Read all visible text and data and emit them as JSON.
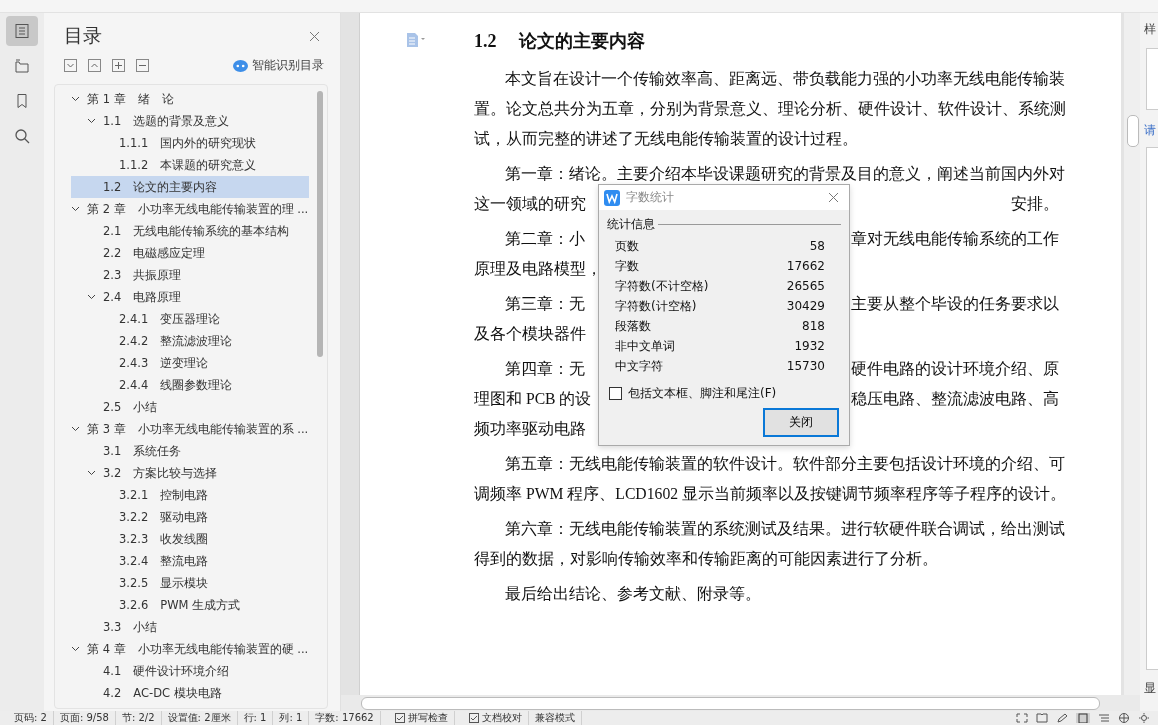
{
  "rail": [
    {
      "kind": "toc",
      "selected": true
    },
    {
      "kind": "nav",
      "selected": false
    },
    {
      "kind": "bookmark",
      "selected": false
    },
    {
      "kind": "search",
      "selected": false
    }
  ],
  "toc": {
    "title": "目录",
    "smart_label": "智能识别目录",
    "items": [
      {
        "number": "第 1 章",
        "title": "绪　论",
        "expanded": true,
        "selected": false,
        "children": [
          {
            "number": "1.1",
            "title": "选题的背景及意义",
            "expanded": true,
            "selected": false,
            "children": [
              {
                "number": "1.1.1",
                "title": "国内外的研究现状",
                "selected": false
              },
              {
                "number": "1.1.2",
                "title": "本课题的研究意义",
                "selected": false
              }
            ]
          },
          {
            "number": "1.2",
            "title": "论文的主要内容",
            "selected": true
          }
        ]
      },
      {
        "number": "第 2 章",
        "title": "小功率无线电能传输装置的理 ...",
        "expanded": true,
        "selected": false,
        "children": [
          {
            "number": "2.1",
            "title": "无线电能传输系统的基本结构",
            "selected": false
          },
          {
            "number": "2.2",
            "title": "电磁感应定理",
            "selected": false
          },
          {
            "number": "2.3",
            "title": "共振原理",
            "selected": false
          },
          {
            "number": "2.4",
            "title": "电路原理",
            "expanded": true,
            "selected": false,
            "children": [
              {
                "number": "2.4.1",
                "title": "变压器理论",
                "selected": false
              },
              {
                "number": "2.4.2",
                "title": "整流滤波理论",
                "selected": false
              },
              {
                "number": "2.4.3",
                "title": "逆变理论",
                "selected": false
              },
              {
                "number": "2.4.4",
                "title": "线圈参数理论",
                "selected": false
              }
            ]
          },
          {
            "number": "2.5",
            "title": "小结",
            "selected": false
          }
        ]
      },
      {
        "number": "第 3 章",
        "title": "小功率无线电能传输装置的系 ...",
        "expanded": true,
        "selected": false,
        "children": [
          {
            "number": "3.1",
            "title": "系统任务",
            "selected": false
          },
          {
            "number": "3.2",
            "title": "方案比较与选择",
            "expanded": true,
            "selected": false,
            "children": [
              {
                "number": "3.2.1",
                "title": "控制电路",
                "selected": false
              },
              {
                "number": "3.2.2",
                "title": "驱动电路",
                "selected": false
              },
              {
                "number": "3.2.3",
                "title": "收发线圈",
                "selected": false
              },
              {
                "number": "3.2.4",
                "title": "整流电路",
                "selected": false
              },
              {
                "number": "3.2.5",
                "title": "显示模块",
                "selected": false
              },
              {
                "number": "3.2.6",
                "title": "PWM 生成方式",
                "selected": false
              }
            ]
          },
          {
            "number": "3.3",
            "title": "小结",
            "selected": false
          }
        ]
      },
      {
        "number": "第 4 章",
        "title": "小功率无线电能传输装置的硬 ...",
        "expanded": true,
        "selected": false,
        "children": [
          {
            "number": "4.1",
            "title": "硬件设计环境介绍",
            "selected": false
          },
          {
            "number": "4.2",
            "title": "AC-DC 模块电路",
            "selected": false
          }
        ]
      }
    ]
  },
  "document": {
    "heading_number": "1.2",
    "heading": "论文的主要内容",
    "lines": [
      {
        "kind": "first",
        "left": "本文旨在设计一个传输效率高、距离远、带负载能力强的小功率无线电能传输装"
      },
      {
        "kind": "cont",
        "left": "置。论文总共分为五章，分别为背景意义、理论分析、硬件设计、软件设计、系统测"
      },
      {
        "kind": "cont",
        "left": "试，从而完整的讲述了无线电能传输装置的设计过程。"
      },
      {
        "kind": "first",
        "left": "第一章：绪论。主要介绍本毕设课题研究的背景及目的意义，阐述当前国内外对"
      },
      {
        "kind": "cont",
        "left": "这一领域的研究",
        "right": "安排。"
      },
      {
        "kind": "first",
        "left": "第二章：小",
        "right": "章对无线电能传输系统的工作"
      },
      {
        "kind": "cont",
        "left": "原理及电路模型，"
      },
      {
        "kind": "first",
        "left": "第三章：无",
        "right": "主要从整个毕设的任务要求以"
      },
      {
        "kind": "cont",
        "left": "及各个模块器件"
      },
      {
        "kind": "first",
        "left": "第四章：无",
        "right": "硬件电路的设计环境介绍、原"
      },
      {
        "kind": "cont",
        "left": "理图和 PCB 的设",
        "right": "稳压电路、整流滤波电路、高"
      },
      {
        "kind": "cont",
        "left": "频功率驱动电路"
      },
      {
        "kind": "first",
        "left": "第五章：无线电能传输装置的软件设计。软件部分主要包括设计环境的介绍、可"
      },
      {
        "kind": "cont",
        "left": "调频率 PWM 程序、LCD1602 显示当前频率以及按键调节频率程序等子程序的设计。"
      },
      {
        "kind": "first",
        "left": "第六章：无线电能传输装置的系统测试及结果。进行软硬件联合调试，给出测试"
      },
      {
        "kind": "cont",
        "left": "得到的数据，对影响传输效率和传输距离的可能因素进行了分析。"
      },
      {
        "kind": "first",
        "left": "最后给出结论、参考文献、附录等。"
      }
    ]
  },
  "dialog": {
    "title": "字数统计",
    "group": "统计信息",
    "stats": [
      {
        "label": "页数",
        "value": "58"
      },
      {
        "label": "字数",
        "value": "17662"
      },
      {
        "label": "字符数(不计空格)",
        "value": "26565"
      },
      {
        "label": "字符数(计空格)",
        "value": "30429"
      },
      {
        "label": "段落数",
        "value": "818"
      },
      {
        "label": "非中文单词",
        "value": "1932"
      },
      {
        "label": "中文字符",
        "value": "15730"
      }
    ],
    "checkbox": {
      "label": "包括文本框、脚注和尾注(F)",
      "checked": false
    },
    "button": {
      "label": "关闭",
      "focused": true
    }
  },
  "right_panel": {
    "top": "样",
    "link": "请",
    "bottom": "显"
  },
  "status_bar": [
    {
      "kind": "text",
      "text": "页码: 2"
    },
    {
      "kind": "text",
      "text": "页面: 9/58"
    },
    {
      "kind": "text",
      "text": "节: 2/2"
    },
    {
      "kind": "text",
      "text": "设置值: 2厘米"
    },
    {
      "kind": "text",
      "text": "行: 1"
    },
    {
      "kind": "text",
      "text": "列: 1"
    },
    {
      "kind": "text",
      "text": "字数: 17662"
    },
    {
      "kind": "check",
      "text": "拼写检查"
    },
    {
      "kind": "check",
      "text": "文档校对"
    },
    {
      "kind": "text",
      "text": "兼容模式"
    }
  ]
}
